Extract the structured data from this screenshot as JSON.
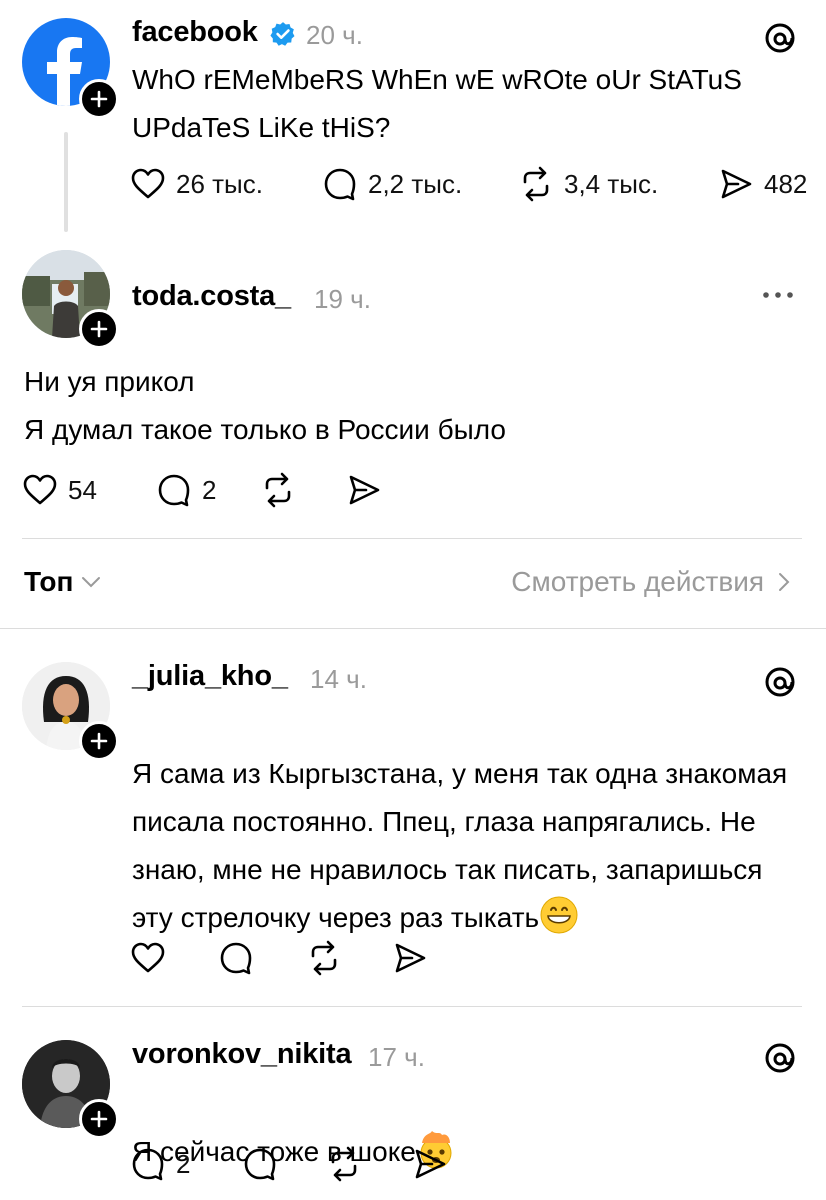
{
  "post": {
    "username": "facebook",
    "time": "20 ч.",
    "text": "WhO rEMeMbeRS WhEn wE wROte oUr StATuS UPdaTeS LiKe tHiS?",
    "likes": "26 тыс.",
    "comments": "2,2 тыс.",
    "reposts": "3,4 тыс.",
    "shares": "482"
  },
  "reply1": {
    "username": "toda.costa_",
    "time": "19 ч.",
    "text": "Ни  уя прикол\nЯ думал такое только в России было",
    "likes": "54",
    "comments": "2"
  },
  "sort": {
    "label": "Топ",
    "activity_link": "Смотреть действия"
  },
  "comments": [
    {
      "username": "_julia_kho_",
      "time": "14 ч.",
      "text": "Я сама из Кыргызстана, у меня так одна знакомая писала постоянно. Ппец, глаза напрягались. Не знаю, мне не нравилось так писать, запаришься эту стрелочку через раз тыкать"
    },
    {
      "username": "voronkov_nikita",
      "time": "17 ч.",
      "text": "Я сейчас тоже в шоке",
      "comments": "2"
    }
  ],
  "colors": {
    "facebook_blue": "#1877f2",
    "verified_blue": "#1d9bf0",
    "muted": "#9a9a9a"
  }
}
